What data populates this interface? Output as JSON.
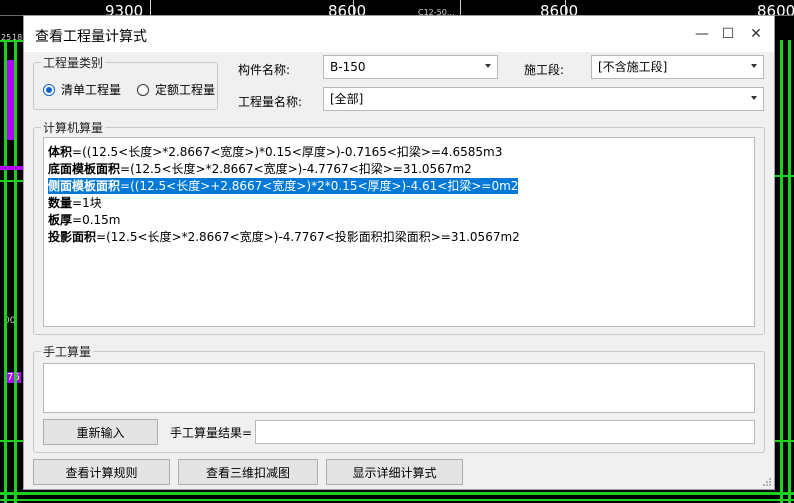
{
  "cad_background": {
    "dimension_labels": [
      "9300",
      "8600",
      "8600",
      "8600"
    ],
    "small_labels": [
      "25",
      "18",
      "C12-50...",
      "00",
      "76"
    ],
    "colors": {
      "background": "#000000",
      "green": "#1ed01e",
      "magenta": "#b000ff"
    }
  },
  "dialog": {
    "title": "查看工程量计算式",
    "controls": {
      "minimize": "—",
      "maximize": "☐",
      "close": "✕"
    },
    "quantity_type": {
      "group_label": "工程量类别",
      "options": [
        {
          "label": "清单工程量",
          "selected": true
        },
        {
          "label": "定额工程量",
          "selected": false
        }
      ]
    },
    "component_name": {
      "label": "构件名称:",
      "value": "B-150"
    },
    "construction_section": {
      "label": "施工段:",
      "value": "[不含施工段]"
    },
    "quantity_name": {
      "label": "工程量名称:",
      "value": "[全部]"
    },
    "computer_calc": {
      "group_label": "计算机算量",
      "lines": [
        {
          "name": "体积",
          "formula": "=((12.5<长度>*2.8667<宽度>)*0.15<厚度>)-0.7165<扣梁>=4.6585m3",
          "selected": false
        },
        {
          "name": "底面模板面积",
          "formula": "=(12.5<长度>*2.8667<宽度>)-4.7767<扣梁>=31.0567m2",
          "selected": false
        },
        {
          "name": "侧面模板面积",
          "formula": "=((12.5<长度>+2.8667<宽度>)*2*0.15<厚度>)-4.61<扣梁>=0m2",
          "selected": true
        },
        {
          "name": "数量",
          "formula": "=1块",
          "selected": false
        },
        {
          "name": "板厚",
          "formula": "=0.15m",
          "selected": false
        },
        {
          "name": "投影面积",
          "formula": "=(12.5<长度>*2.8667<宽度>)-4.7767<投影面积扣梁面积>=31.0567m2",
          "selected": false
        }
      ]
    },
    "manual_calc": {
      "group_label": "手工算量",
      "reenter_button": "重新输入",
      "result_label": "手工算量结果=",
      "result_value": ""
    },
    "bottom_buttons": {
      "view_rules": "查看计算规则",
      "view_3d": "查看三维扣减图",
      "show_detail": "显示详细计算式"
    },
    "accent_color": "#0078d7"
  }
}
